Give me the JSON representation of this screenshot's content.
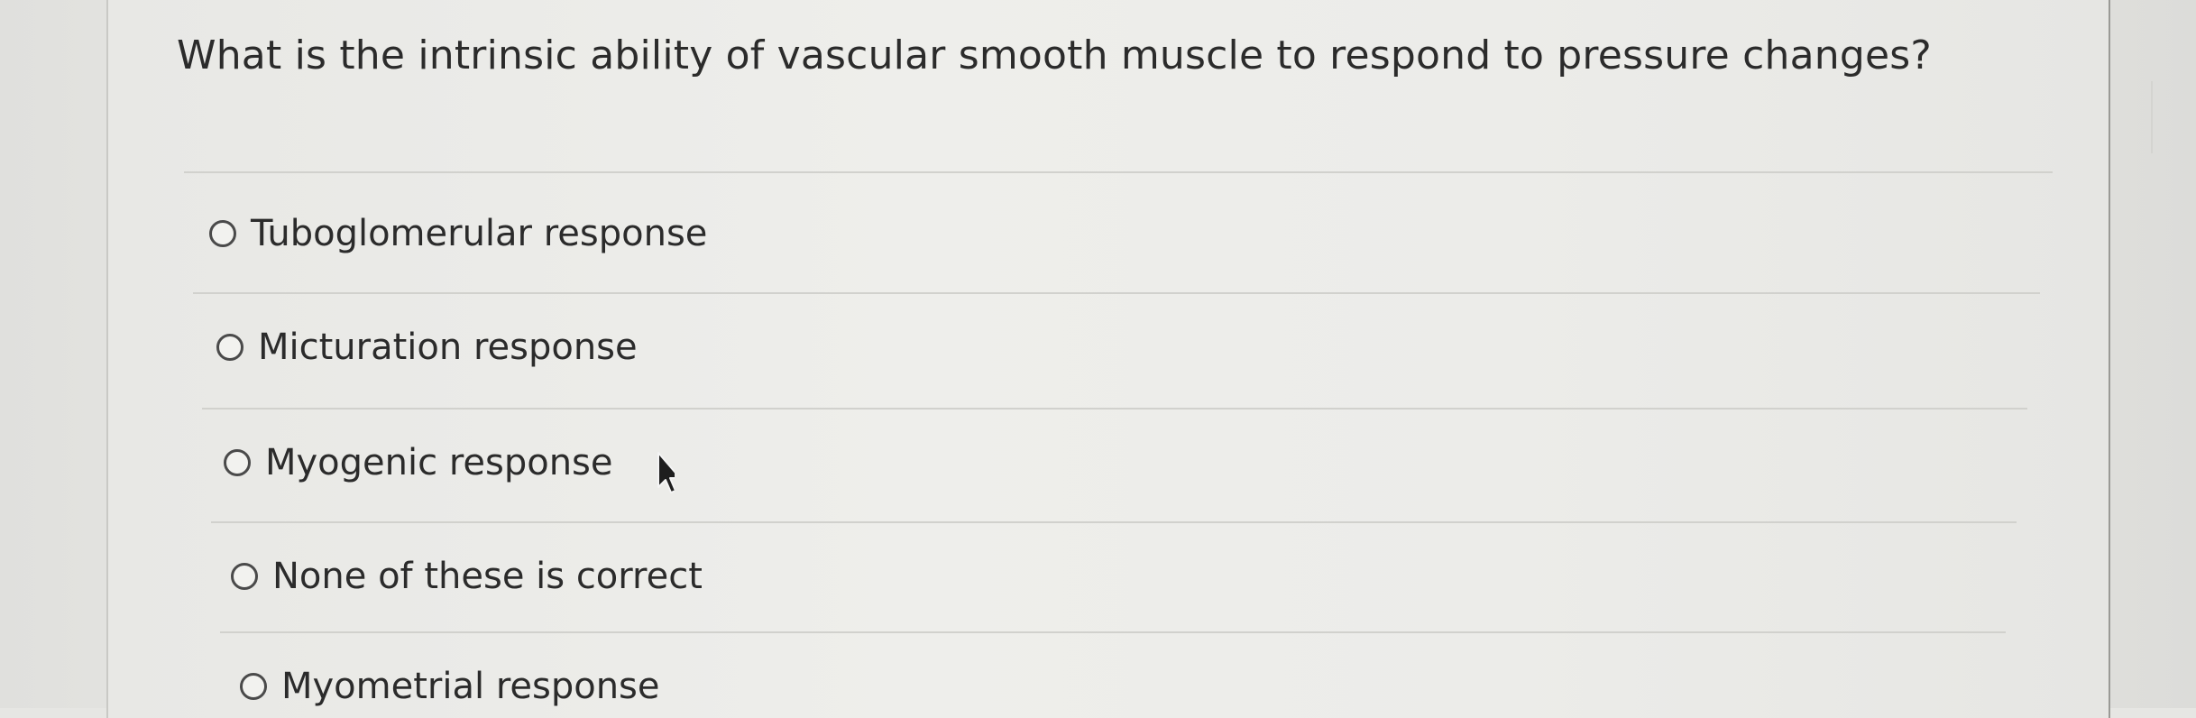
{
  "question": {
    "text": "What is the intrinsic ability of vascular smooth muscle to respond to pressure changes?"
  },
  "options": [
    {
      "label": "Tuboglomerular response",
      "selected": false
    },
    {
      "label": "Micturation response",
      "selected": false
    },
    {
      "label": "Myogenic response",
      "selected": false
    },
    {
      "label": "None of these is correct",
      "selected": false
    },
    {
      "label": "Myometrial response",
      "selected": false
    }
  ],
  "colors": {
    "text": "#2b2b2b",
    "radio_border": "#4a4a4a",
    "divider": "#d1d1cd",
    "background": "#e9e9e6"
  },
  "icons": {
    "cursor": "mouse-pointer-icon",
    "radio": "radio-unselected-icon"
  }
}
